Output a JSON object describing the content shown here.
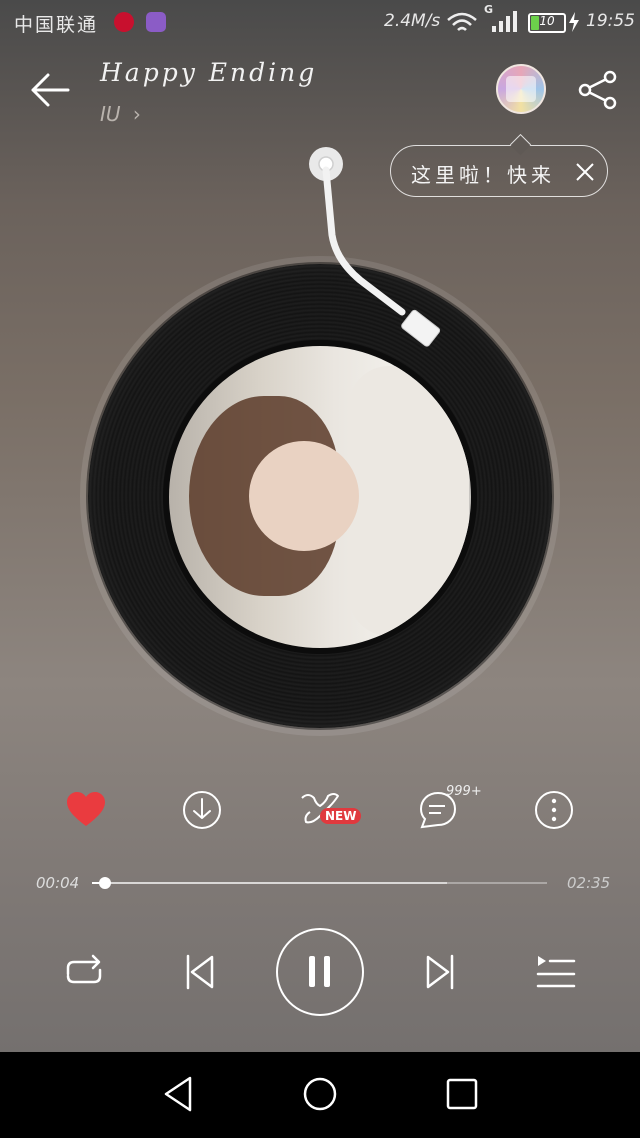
{
  "status_bar": {
    "carrier": "中国联通",
    "net_speed": "2.4M/s",
    "network_type": "G",
    "battery_level": "10",
    "time": "19:55",
    "icons": [
      "netease-music-icon",
      "gallery-icon",
      "wifi-icon",
      "signal-icon",
      "battery-icon",
      "charging-icon"
    ]
  },
  "header": {
    "title": "Happy Ending",
    "artist": "IU",
    "artist_chevron": "›"
  },
  "hint": {
    "text": "这里啦！快来"
  },
  "actions": {
    "new_badge": "NEW",
    "comment_count": "999+",
    "like_color": "#ea3b3f"
  },
  "player": {
    "elapsed": "00:04",
    "total": "02:35",
    "progress": 0.028,
    "buffered": 0.78
  },
  "colors": {
    "accent": "#ea3b3f",
    "badge": "#e0393e"
  }
}
